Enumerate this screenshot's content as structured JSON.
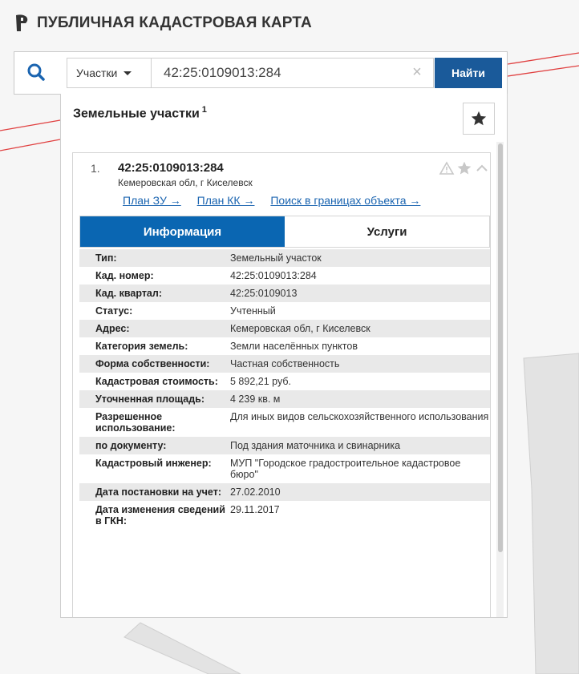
{
  "header": {
    "title": "ПУБЛИЧНАЯ КАДАСТРОВАЯ КАРТА"
  },
  "search": {
    "type_selected": "Участки",
    "query": "42:25:0109013:284",
    "find_label": "Найти"
  },
  "panel": {
    "title": "Земельные участки",
    "count": "1"
  },
  "result": {
    "number": "1.",
    "cad_number": "42:25:0109013:284",
    "address": "Кемеровская обл, г Киселевск",
    "links": [
      "План ЗУ →",
      "План КК →",
      "Поиск в границах объекта →"
    ]
  },
  "tabs": [
    "Информация",
    "Услуги"
  ],
  "info": {
    "rows": [
      {
        "label": "Тип:",
        "value": "Земельный участок"
      },
      {
        "label": "Кад. номер:",
        "value": "42:25:0109013:284"
      },
      {
        "label": "Кад. квартал:",
        "value": "42:25:0109013"
      },
      {
        "label": "Статус:",
        "value": "Учтенный"
      },
      {
        "label": "Адрес:",
        "value": "Кемеровская обл, г Киселевск"
      },
      {
        "label": "Категория земель:",
        "value": "Земли населённых пунктов"
      },
      {
        "label": "Форма собственности:",
        "value": "Частная собственность"
      },
      {
        "label": "Кадастровая стоимость:",
        "value": "5 892,21 руб."
      },
      {
        "label": "Уточненная площадь:",
        "value": "4 239 кв. м"
      },
      {
        "label": "Разрешенное использование:",
        "value": "Для иных видов сельскохозяйственного использования"
      },
      {
        "label": "по документу:",
        "value": "Под здания маточника и свинарника"
      },
      {
        "label": "Кадастровый инженер:",
        "value": "МУП \"Городское градостроительное кадастровое бюро\""
      },
      {
        "label": "Дата постановки на учет:",
        "value": "27.02.2010"
      },
      {
        "label": "Дата изменения сведений в ГКН:",
        "value": "29.11.2017"
      }
    ]
  },
  "colors": {
    "accent": "#0a66b2",
    "button": "#1a5a9a",
    "link": "#1a64b0",
    "map_line": "#e04040"
  },
  "icons": {
    "logo": "pkk-logo-icon",
    "search": "search-icon",
    "clear": "clear-icon",
    "bookmark": "star-icon",
    "warning": "warning-icon",
    "collapse": "chevron-up-icon"
  }
}
